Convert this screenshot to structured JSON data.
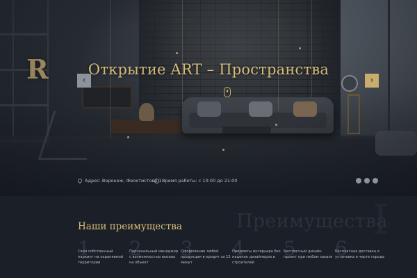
{
  "hero": {
    "title": "Открытие ART – Пространства",
    "prev_label": "‹",
    "next_label": "›",
    "logo_letter": "R"
  },
  "info": {
    "address": "Адрес: Воронеж, Феоктистова 1",
    "hours": "Время работы: с 10:00 до 21:00"
  },
  "social": [
    "vk-icon",
    "instagram-icon",
    "facebook-icon"
  ],
  "advantages": {
    "title": "Наши преимущества",
    "background_word": "Преимущества",
    "background_letter": "I",
    "items": [
      {
        "num": "1",
        "text": "Свой собственный паркинг на охраняемой территории"
      },
      {
        "num": "2",
        "text": "Персональный менеджер с возможностью вызова на объект"
      },
      {
        "num": "3",
        "text": "Оформление любой продукции в кредит за 15 минут"
      },
      {
        "num": "4",
        "text": "Предметы интерьера без наценок дизайнеров и строителей"
      },
      {
        "num": "5",
        "text": "Бесплатный дизайн проект при любом заказе"
      },
      {
        "num": "6",
        "text": "Бесплатная доставка и установка в черте города"
      }
    ]
  },
  "colors": {
    "accent": "#c8ad6c",
    "title_gold": "#d6bb7a",
    "background": "#1b2028"
  }
}
